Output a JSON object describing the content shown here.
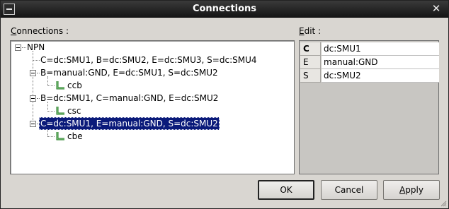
{
  "window": {
    "title": "Connections",
    "close_glyph": "✕"
  },
  "connections_panel": {
    "label_prefix": "",
    "label_mnemonic": "C",
    "label_rest": "onnections :",
    "tree": {
      "root": "NPN",
      "children": [
        {
          "label": "C=dc:SMU1, B=dc:SMU2, E=dc:SMU3, S=dc:SMU4"
        },
        {
          "label": "B=manual:GND, E=dc:SMU1, S=dc:SMU2",
          "leaf": "ccb"
        },
        {
          "label": "B=dc:SMU1, C=manual:GND, E=dc:SMU2",
          "leaf": "csc"
        },
        {
          "label": "C=dc:SMU1, E=manual:GND, S=dc:SMU2",
          "leaf": "cbe",
          "selected": true
        }
      ]
    }
  },
  "edit_panel": {
    "label_mnemonic": "E",
    "label_rest": "dit :",
    "rows": [
      {
        "key": "C",
        "value": "dc:SMU1"
      },
      {
        "key": "E",
        "value": "manual:GND"
      },
      {
        "key": "S",
        "value": "dc:SMU2"
      }
    ]
  },
  "buttons": {
    "ok": "OK",
    "cancel": "Cancel",
    "apply_mnemonic": "A",
    "apply_rest": "pply"
  },
  "colors": {
    "selection": "#0a1a7a",
    "leaf_icon": "#1e7a1e"
  }
}
